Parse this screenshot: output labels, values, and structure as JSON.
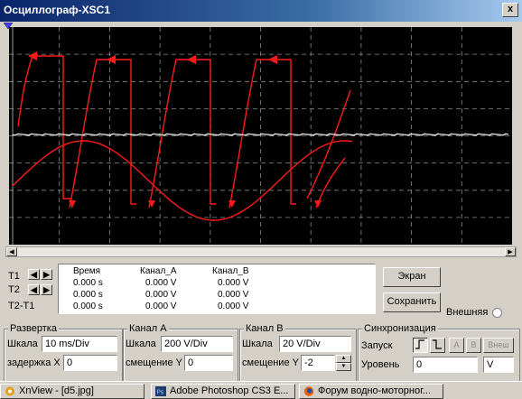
{
  "window": {
    "title": "Осциллограф-XSC1",
    "close_glyph": "x"
  },
  "colors": {
    "trace": "#ff1a1a",
    "cursor_line": "#ffffff",
    "grid": "#8a8a8a",
    "screen_bg": "#000000",
    "titlebar": "#0a246a"
  },
  "readout": {
    "headers": [
      "Время",
      "Канал_A",
      "Канал_B"
    ],
    "rows": [
      {
        "label": "T1",
        "time": "0.000 s",
        "a": "0.000 V",
        "b": "0.000 V"
      },
      {
        "label": "T2",
        "time": "0.000 s",
        "a": "0.000 V",
        "b": "0.000 V"
      },
      {
        "label": "T2-T1",
        "time": "0.000 s",
        "a": "0.000 V",
        "b": "0.000 V"
      }
    ]
  },
  "buttons": {
    "screen": "Экран",
    "save": "Сохранить",
    "external": "Внешняя"
  },
  "timebase": {
    "legend": "Развертка",
    "scale_label": "Шкала",
    "scale_value": "10 ms/Div",
    "delay_label": "задержка X",
    "delay_value": "0"
  },
  "channel_a": {
    "legend": "Канал A",
    "scale_label": "Шкала",
    "scale_value": "200  V/Div",
    "offset_label": "смещение Y",
    "offset_value": "0"
  },
  "channel_b": {
    "legend": "Канал B",
    "scale_label": "Шкала",
    "scale_value": "20  V/Div",
    "offset_label": "смещение Y",
    "offset_value": "-2"
  },
  "trigger": {
    "legend": "Синхронизация",
    "start_label": "Запуск",
    "level_label": "Уровень",
    "level_value": "0",
    "level_unit": "V",
    "src_a": "A",
    "src_b": "B",
    "src_ext": "Внеш"
  },
  "taskbar": [
    {
      "label": "XnView - [d5.jpg]",
      "icon": "xnview-icon"
    },
    {
      "label": "Adobe Photoshop CS3 E...",
      "icon": "photoshop-icon"
    },
    {
      "label": "Форум водно-моторног...",
      "icon": "firefox-icon"
    }
  ]
}
